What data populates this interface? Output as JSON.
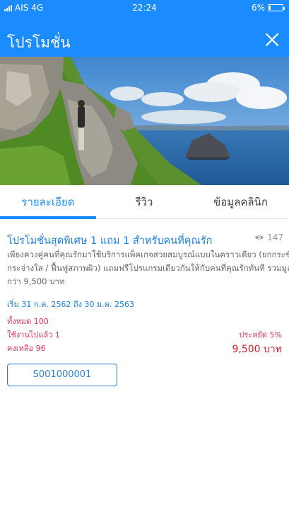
{
  "status_bar": {
    "carrier": "AIS 4G",
    "time": "22:24",
    "battery": "6%"
  },
  "header": {
    "title": "โปรโมชั่น",
    "close_icon": "close-icon",
    "background_color": "#1a8cff"
  },
  "tabs": [
    {
      "label": "รายละเอียด",
      "active": true
    },
    {
      "label": "รีวิว",
      "active": false
    },
    {
      "label": "ข้อมูลคลินิก",
      "active": false
    }
  ],
  "promotion": {
    "title": "โปรโมชั่นสุดพิเศษ 1 แถม 1 สำหรับคนที่คุณรัก",
    "views": "147",
    "description_lines": [
      "เพียงควงคู่คนที่คุณรักมาใช้บริการแพ็คเกจสวยสมบูรณ์แบบในคราวเดียว (ยกกระชับ /",
      "กระจ่างใส / ฟื้นฟูสภาพผิว) แถมฟรีโปรแกรมเดียวกันให้กับคนที่คุณรักทันที รวมมูลค่า",
      "กว่า 9,500 บาท"
    ],
    "dates": "เริ่ม 31 ก.ค. 2562 ถึง 30 ม.ค. 2563",
    "total": "ทั้งหมด 100",
    "used": "ใช้งานไปแล้ว 1",
    "remaining": "คงเหลือ 96",
    "saving": "ประหยัด 5%",
    "price": "9,500 บาท",
    "code": "S001000001"
  },
  "colors": {
    "accent": "#1a8cff",
    "highlight": "#e4325f",
    "price": "#e11d2a"
  }
}
